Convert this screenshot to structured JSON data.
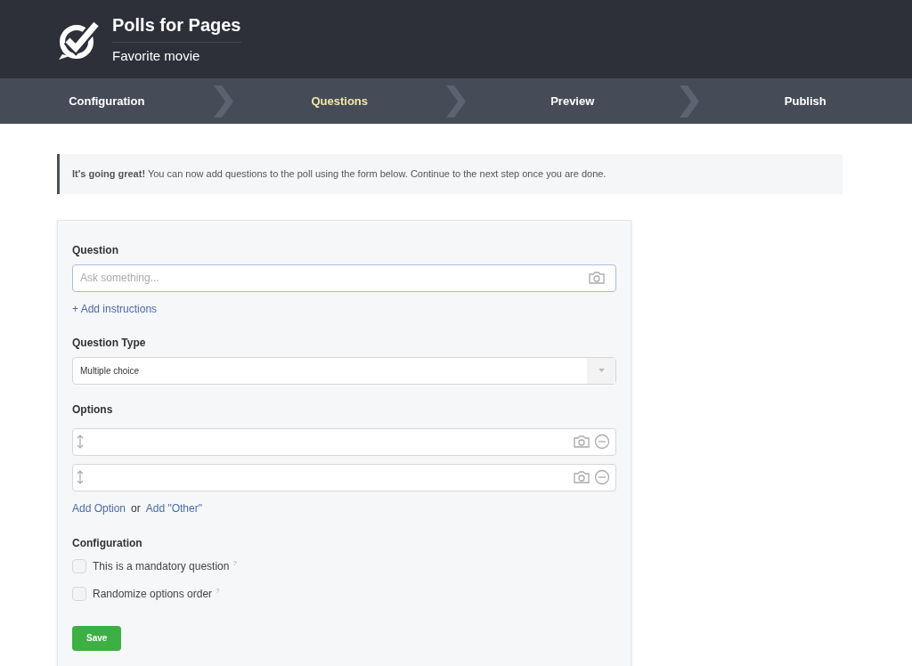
{
  "header": {
    "app_title": "Polls for Pages",
    "poll_name": "Favorite movie"
  },
  "steps": [
    {
      "label": "Configuration",
      "selected": false
    },
    {
      "label": "Questions",
      "selected": true
    },
    {
      "label": "Preview",
      "selected": false
    },
    {
      "label": "Publish",
      "selected": false
    }
  ],
  "notice": "**It's going great!** You can now add questions to the poll using the form below. Continue to the next step once you are done.",
  "form": {
    "question_label": "Question",
    "question_placeholder": "Ask something...",
    "add_instructions": "+ Add instructions",
    "type_label": "Question Type",
    "type_value": "Multiple choice",
    "options_label": "Options",
    "options": [
      {
        "kind": "blank"
      },
      {
        "kind": "blank"
      }
    ],
    "add_option": "Add Option",
    "or": "or",
    "add_other": "Add \"Other\"",
    "config_label": "Configuration",
    "settings": [
      {
        "label": "This is a mandatory question",
        "help": "?",
        "checked": false
      },
      {
        "label": "Randomize options order",
        "help": "?",
        "checked": false
      }
    ],
    "save": "Save"
  }
}
